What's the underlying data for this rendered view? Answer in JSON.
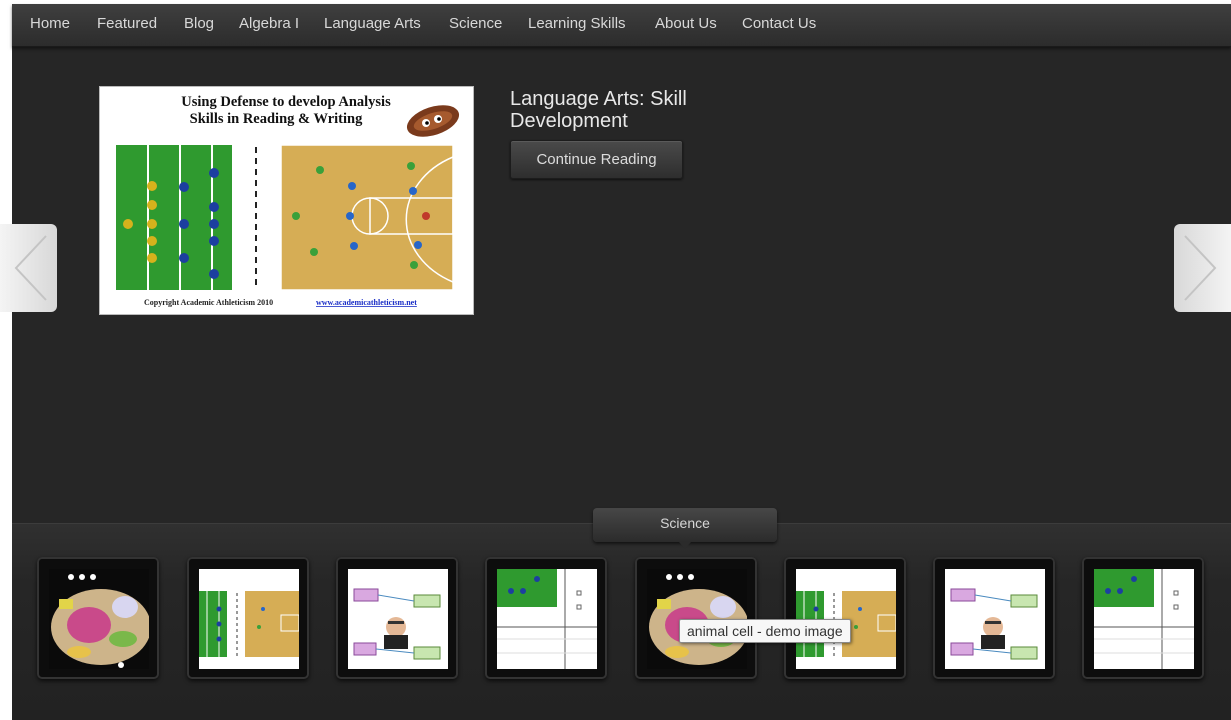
{
  "nav": {
    "items": [
      {
        "label": "Home"
      },
      {
        "label": "Featured"
      },
      {
        "label": "Blog"
      },
      {
        "label": "Algebra I"
      },
      {
        "label": "Language Arts"
      },
      {
        "label": "Science"
      },
      {
        "label": "Learning Skills"
      },
      {
        "label": "About Us"
      },
      {
        "label": "Contact Us"
      }
    ]
  },
  "slide": {
    "image": {
      "heading_line1": "Using Defense to develop Analysis",
      "heading_line2": "Skills in Reading & Writing",
      "copyright": "Copyright Academic Athleticism 2010",
      "link": "www.academicathleticism.net"
    },
    "title": "Language Arts: Skill Development",
    "button_label": "Continue Reading"
  },
  "strip": {
    "category": "Science",
    "tooltip": "animal cell - demo image",
    "thumbnails": [
      {
        "kind": "animal-cell"
      },
      {
        "kind": "defense-analysis"
      },
      {
        "kind": "flow-diagram"
      },
      {
        "kind": "graph-grid"
      },
      {
        "kind": "animal-cell"
      },
      {
        "kind": "defense-analysis"
      },
      {
        "kind": "flow-diagram"
      },
      {
        "kind": "graph-grid"
      }
    ]
  },
  "colors": {
    "background": "#262626",
    "nav_text": "#d8d8d8",
    "field_green": "#2f9a2f",
    "court_wood": "#d6ad55"
  }
}
